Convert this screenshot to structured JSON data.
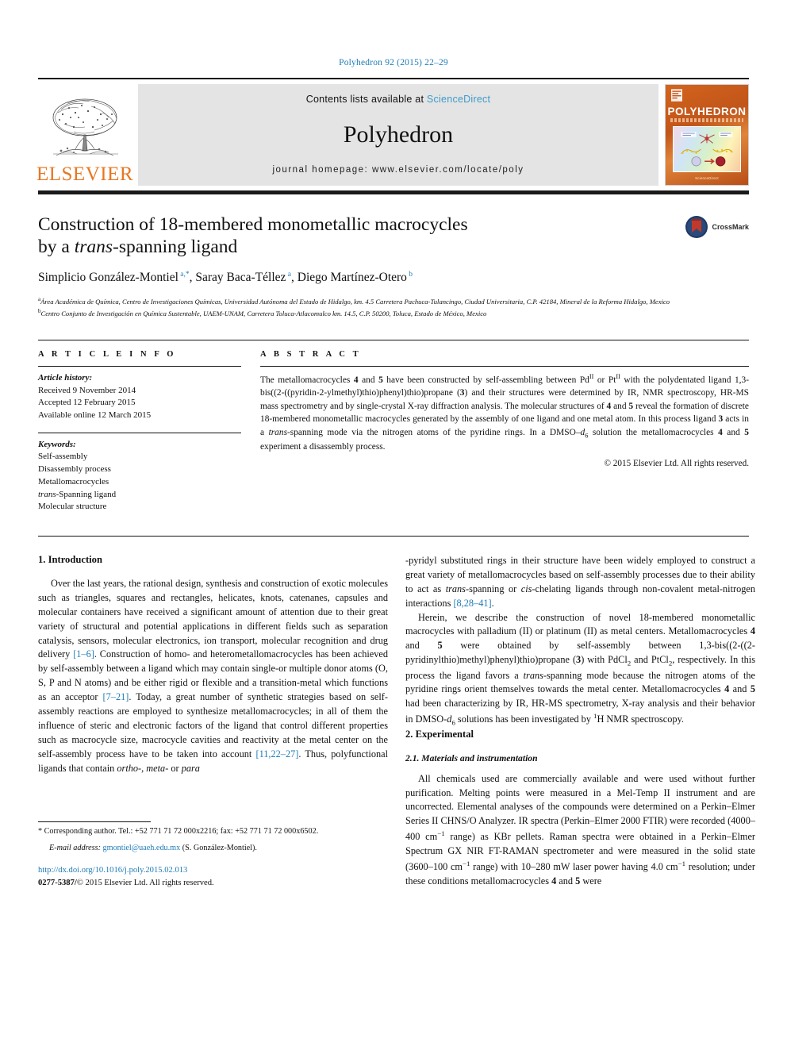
{
  "running_head": "Polyhedron 92 (2015) 22–29",
  "masthead": {
    "contents_prefix": "Contents lists available at ",
    "sciencedirect": "ScienceDirect",
    "journal_name": "Polyhedron",
    "homepage": "journal homepage: www.elsevier.com/locate/poly",
    "publisher_logo_text": "ELSEVIER",
    "cover_title": "POLYHEDRON",
    "cover_footer": "ScienceDirect",
    "accent_orange": "#e87722",
    "link_blue": "#3e9bca"
  },
  "title_block": {
    "title_line1": "Construction of 18-membered monometallic macrocycles",
    "title_line2_pre": "by a ",
    "title_line2_it": "trans",
    "title_line2_post": "-spanning ligand",
    "crossmark_label": "CrossMark",
    "authors": [
      {
        "name": "Simplicio González-Montiel",
        "marks": "a,*",
        "sep": ", "
      },
      {
        "name": "Saray Baca-Téllez",
        "marks": "a",
        "sep": ", "
      },
      {
        "name": "Diego Martínez-Otero",
        "marks": "b",
        "sep": ""
      }
    ],
    "affiliations": [
      {
        "mark": "a",
        "text": "Área Académica de Química, Centro de Investigaciones Químicas, Universidad Autónoma del Estado de Hidalgo, km. 4.5 Carretera Pachuca-Tulancingo, Ciudad Universitaria, C.P. 42184, Mineral de la Reforma Hidalgo, Mexico"
      },
      {
        "mark": "b",
        "text": "Centro Conjunto de Investigación en Química Sustentable, UAEM-UNAM, Carretera Toluca-Atlacomulco km. 14.5, C.P. 50200, Toluca, Estado de México, Mexico"
      }
    ]
  },
  "article_info": {
    "heading": "A R T I C L E    I N F O",
    "history_label": "Article history:",
    "history": [
      "Received 9 November 2014",
      "Accepted 12 February 2015",
      "Available online 12 March 2015"
    ],
    "keywords_label": "Keywords:",
    "keywords": [
      "Self-assembly",
      "Disassembly process",
      "Metallomacrocycles",
      "trans-Spanning ligand",
      "Molecular structure"
    ]
  },
  "abstract": {
    "heading": "A B S T R A C T",
    "text_parts": [
      {
        "t": "The metallomacrocycles "
      },
      {
        "t": "4",
        "s": "b"
      },
      {
        "t": " and "
      },
      {
        "t": "5",
        "s": "b"
      },
      {
        "t": " have been constructed by self-assembling between Pd"
      },
      {
        "t": "II",
        "s": "sup"
      },
      {
        "t": " or Pt"
      },
      {
        "t": "II",
        "s": "sup"
      },
      {
        "t": " with the polydentated ligand 1,3-bis((2-((pyridin-2-ylmethyl)thio)phenyl)thio)propane ("
      },
      {
        "t": "3",
        "s": "b"
      },
      {
        "t": ") and their structures were determined by IR, NMR spectroscopy, HR-MS mass spectrometry and by single-crystal X-ray diffraction analysis. The molecular structures of "
      },
      {
        "t": "4",
        "s": "b"
      },
      {
        "t": " and "
      },
      {
        "t": "5",
        "s": "b"
      },
      {
        "t": " reveal the formation of discrete 18-membered monometallic macrocycles generated by the assembly of one ligand and one metal atom. In this process ligand "
      },
      {
        "t": "3",
        "s": "b"
      },
      {
        "t": " acts in a "
      },
      {
        "t": "trans",
        "s": "i"
      },
      {
        "t": "-spanning mode via the nitrogen atoms of the pyridine rings. In a DMSO–"
      },
      {
        "t": "d",
        "s": "i"
      },
      {
        "t": "6",
        "s": "sub"
      },
      {
        "t": " solution the metallomacrocycles "
      },
      {
        "t": "4",
        "s": "b"
      },
      {
        "t": " and "
      },
      {
        "t": "5",
        "s": "b"
      },
      {
        "t": " experiment a disassembly process."
      }
    ],
    "copyright": "© 2015 Elsevier Ltd. All rights reserved."
  },
  "sections": {
    "intro_heading": "1. Introduction",
    "experimental_heading": "2. Experimental",
    "materials_heading": "2.1. Materials and instrumentation"
  },
  "body": {
    "left_p1": [
      {
        "t": "Over the last years, the rational design, synthesis and construction of exotic molecules such as triangles, squares and rectangles, helicates, knots, catenanes, capsules and molecular containers have received a significant amount of attention due to their great variety of structural and potential applications in different fields such as separation catalysis, sensors, molecular electronics, ion transport, molecular recognition and drug delivery "
      },
      {
        "t": "[1–6]",
        "s": "ref"
      },
      {
        "t": ". Construction of homo- and heterometallomacrocycles has been achieved by self-assembly between a ligand which may contain single-or multiple donor atoms (O, S, P and N atoms) and be either rigid or flexible and a transition-metal which functions as an acceptor "
      },
      {
        "t": "[7–21]",
        "s": "ref"
      },
      {
        "t": ". Today, a great number of synthetic strategies based on self-assembly reactions are employed to synthesize metallomacrocycles; in all of them the influence of steric and electronic factors of the ligand that control different properties such as macrocycle size, macrocycle cavities and reactivity at the metal center on the self-assembly process have to be taken into account "
      },
      {
        "t": "[11,22–27]",
        "s": "ref"
      },
      {
        "t": ". Thus, polyfunctional ligands that contain "
      },
      {
        "t": "ortho",
        "s": "i"
      },
      {
        "t": "-, "
      },
      {
        "t": "meta",
        "s": "i"
      },
      {
        "t": "- or "
      },
      {
        "t": "para",
        "s": "i"
      },
      {
        "t": "-pyridyl substituted rings in their structure have been widely employed to construct a great variety of metallomacrocycles based on self-assembly processes due to their ability to act as "
      },
      {
        "t": "trans",
        "s": "i"
      },
      {
        "t": "-spanning or "
      },
      {
        "t": "cis",
        "s": "i"
      },
      {
        "t": "-chelating ligands through non-covalent metal-nitrogen interactions "
      },
      {
        "t": "[8,28–41]",
        "s": "ref"
      },
      {
        "t": "."
      }
    ],
    "right_p2": [
      {
        "t": "Herein, we describe the construction of novel 18-membered monometallic macrocycles with palladium (II) or platinum (II) as metal centers. Metallomacrocycles "
      },
      {
        "t": "4",
        "s": "b"
      },
      {
        "t": " and "
      },
      {
        "t": "5",
        "s": "b"
      },
      {
        "t": " were obtained by self-assembly between 1,3-bis((2-((2-pyridinylthio)methyl)phenyl)thio)propane ("
      },
      {
        "t": "3",
        "s": "b"
      },
      {
        "t": ") with PdCl"
      },
      {
        "t": "2",
        "s": "sub"
      },
      {
        "t": " and PtCl"
      },
      {
        "t": "2",
        "s": "sub"
      },
      {
        "t": ", respectively. In this process the ligand favors a "
      },
      {
        "t": "trans",
        "s": "i"
      },
      {
        "t": "-spanning mode because the nitrogen atoms of the pyridine rings orient themselves towards the metal center. Metallomacrocycles "
      },
      {
        "t": "4",
        "s": "b"
      },
      {
        "t": " and "
      },
      {
        "t": "5",
        "s": "b"
      },
      {
        "t": " had been characterizing by IR, HR-MS spectrometry, X-ray analysis and their behavior in DMSO-"
      },
      {
        "t": "d",
        "s": "i"
      },
      {
        "t": "6",
        "s": "sub"
      },
      {
        "t": " solutions has been investigated by "
      },
      {
        "t": "1",
        "s": "sup"
      },
      {
        "t": "H NMR spectroscopy."
      }
    ],
    "right_p3": [
      {
        "t": "All chemicals used are commercially available and were used without further purification. Melting points were measured in a Mel-Temp II instrument and are uncorrected. Elemental analyses of the compounds were determined on a Perkin–Elmer Series II CHNS/O Analyzer. IR spectra (Perkin–Elmer 2000 FTIR) were recorded (4000–400 cm"
      },
      {
        "t": "−1",
        "s": "sup"
      },
      {
        "t": " range) as KBr pellets. Raman spectra were obtained in a Perkin–Elmer Spectrum GX NIR FT-RAMAN spectrometer and were measured in the solid state (3600–100 cm"
      },
      {
        "t": "−1",
        "s": "sup"
      },
      {
        "t": " range) with 10–280 mW laser power having 4.0 cm"
      },
      {
        "t": "−1",
        "s": "sup"
      },
      {
        "t": " resolution; under these conditions metallomacrocycles "
      },
      {
        "t": "4",
        "s": "b"
      },
      {
        "t": " and "
      },
      {
        "t": "5",
        "s": "b"
      },
      {
        "t": " were"
      }
    ]
  },
  "footer": {
    "corresponding": "* Corresponding author. Tel.: +52 771 71 72 000x2216; fax: +52 771 71 72 000x6502.",
    "email_label": "E-mail address:",
    "email": "gmontiel@uaeh.edu.mx",
    "email_author": "(S. González-Montiel).",
    "doi": "http://dx.doi.org/10.1016/j.poly.2015.02.013",
    "issn_line_prefix": "0277-5387/",
    "issn_line_rest": "© 2015 Elsevier Ltd. All rights reserved."
  }
}
